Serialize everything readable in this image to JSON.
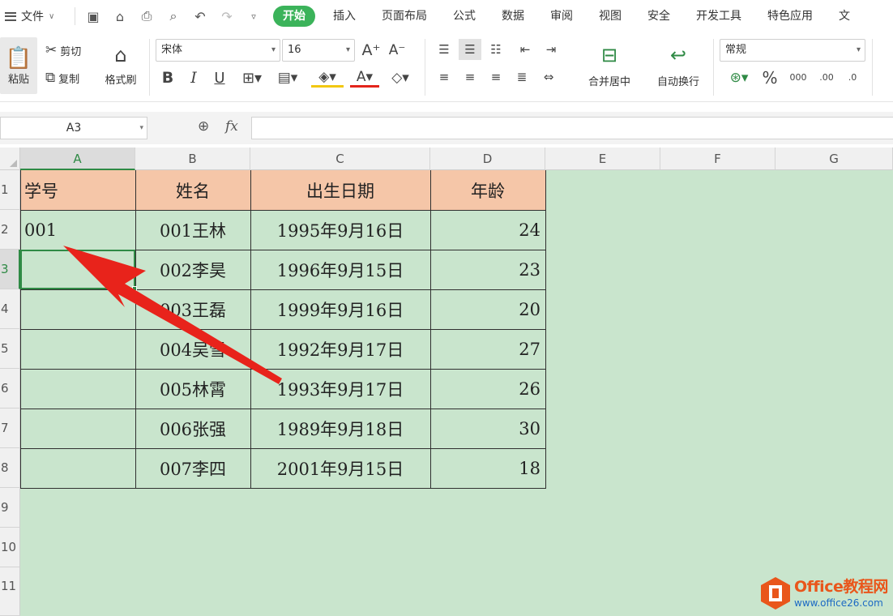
{
  "menu": {
    "file": "文件",
    "quick_icons": [
      "save-icon",
      "format-painter-icon",
      "print-icon",
      "print-preview-icon",
      "undo-icon",
      "redo-icon",
      "customize-icon"
    ],
    "tabs": [
      "开始",
      "插入",
      "页面布局",
      "公式",
      "数据",
      "审阅",
      "视图",
      "安全",
      "开发工具",
      "特色应用",
      "文"
    ],
    "active_tab": "开始"
  },
  "ribbon": {
    "paste": "粘贴",
    "cut": "剪切",
    "copy": "复制",
    "format_painter": "格式刷",
    "font_name": "宋体",
    "font_size": "16",
    "merge_center": "合并居中",
    "wrap_text": "自动换行",
    "number_format": "常规",
    "percent": "%",
    "thousands": "000"
  },
  "formula_bar": {
    "name_box": "A3",
    "fx": "fx",
    "value": ""
  },
  "columns": [
    "A",
    "B",
    "C",
    "D",
    "E",
    "F",
    "G"
  ],
  "selected_column": "A",
  "rows": [
    "1",
    "2",
    "3",
    "4",
    "5",
    "6",
    "7",
    "8",
    "9",
    "10",
    "11"
  ],
  "selected_row": "3",
  "table": {
    "headers": [
      "学号",
      "姓名",
      "出生日期",
      "年龄"
    ],
    "rows": [
      [
        "001",
        "001王林",
        "1995年9月16日",
        "24"
      ],
      [
        "",
        "002李昊",
        "1996年9月15日",
        "23"
      ],
      [
        "",
        "003王磊",
        "1999年9月16日",
        "20"
      ],
      [
        "",
        "004吴雪",
        "1992年9月17日",
        "27"
      ],
      [
        "",
        "005林霄",
        "1993年9月17日",
        "26"
      ],
      [
        "",
        "006张强",
        "1989年9月18日",
        "30"
      ],
      [
        "",
        "007李四",
        "2001年9月15日",
        "18"
      ]
    ]
  },
  "colors": {
    "accent_green": "#3bb35a",
    "sheet_bg": "#c9e5cd",
    "header_fill": "#f5c6a8",
    "arrow": "#e8231b"
  },
  "watermark": {
    "title": "Office教程网",
    "url": "www.office26.com"
  }
}
